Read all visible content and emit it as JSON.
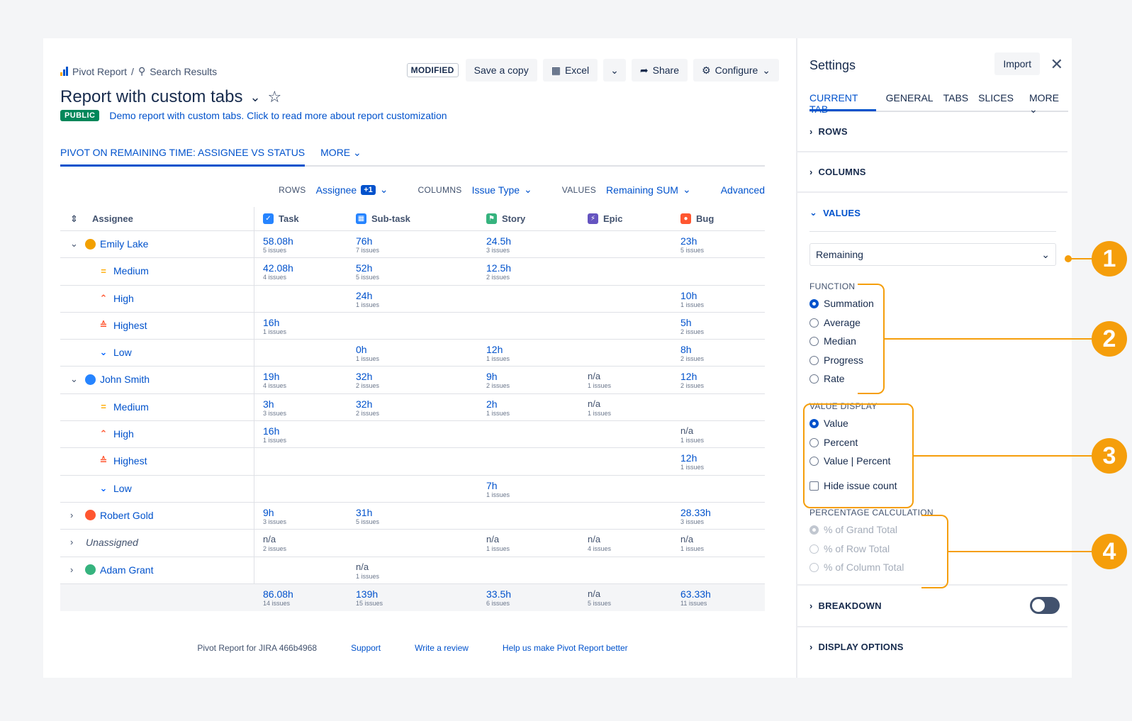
{
  "breadcrumb": {
    "root": "Pivot Report",
    "sep": "/",
    "current": "Search Results"
  },
  "toolbar": {
    "modified": "MODIFIED",
    "save_copy": "Save a copy",
    "excel": "Excel",
    "share": "Share",
    "configure": "Configure"
  },
  "report": {
    "title": "Report with custom tabs",
    "visibility": "PUBLIC",
    "description": "Demo report with custom tabs. Click to read more about report customization"
  },
  "tabs": {
    "active": "PIVOT ON REMAINING TIME: ASSIGNEE VS STATUS",
    "more": "MORE"
  },
  "config": {
    "rows_label": "ROWS",
    "rows_value": "Assignee",
    "rows_extra": "+1",
    "columns_label": "COLUMNS",
    "columns_value": "Issue Type",
    "values_label": "VALUES",
    "values_value": "Remaining SUM",
    "advanced": "Advanced"
  },
  "table": {
    "header": {
      "assignee": "Assignee",
      "task": "Task",
      "subtask": "Sub-task",
      "story": "Story",
      "epic": "Epic",
      "bug": "Bug"
    },
    "rows": [
      {
        "name": "Emily Lake",
        "task": [
          "58.08h",
          "5 issues"
        ],
        "subtask": [
          "76h",
          "7 issues"
        ],
        "story": [
          "24.5h",
          "3 issues"
        ],
        "bug": [
          "23h",
          "5 issues"
        ]
      },
      {
        "name": "Medium",
        "task": [
          "42.08h",
          "4 issues"
        ],
        "subtask": [
          "52h",
          "5 issues"
        ],
        "story": [
          "12.5h",
          "2 issues"
        ]
      },
      {
        "name": "High",
        "subtask": [
          "24h",
          "1 issues"
        ],
        "bug": [
          "10h",
          "1 issues"
        ]
      },
      {
        "name": "Highest",
        "task": [
          "16h",
          "1 issues"
        ],
        "bug": [
          "5h",
          "2 issues"
        ]
      },
      {
        "name": "Low",
        "subtask": [
          "0h",
          "1 issues"
        ],
        "story": [
          "12h",
          "1 issues"
        ],
        "bug": [
          "8h",
          "2 issues"
        ]
      },
      {
        "name": "John Smith",
        "task": [
          "19h",
          "4 issues"
        ],
        "subtask": [
          "32h",
          "2 issues"
        ],
        "story": [
          "9h",
          "2 issues"
        ],
        "epic": [
          "n/a",
          "1 issues"
        ],
        "bug": [
          "12h",
          "2 issues"
        ]
      },
      {
        "name": "Medium",
        "task": [
          "3h",
          "3 issues"
        ],
        "subtask": [
          "32h",
          "2 issues"
        ],
        "story": [
          "2h",
          "1 issues"
        ],
        "epic": [
          "n/a",
          "1 issues"
        ]
      },
      {
        "name": "High",
        "task": [
          "16h",
          "1 issues"
        ],
        "bug": [
          "n/a",
          "1 issues"
        ]
      },
      {
        "name": "Highest",
        "bug": [
          "12h",
          "1 issues"
        ]
      },
      {
        "name": "Low",
        "story": [
          "7h",
          "1 issues"
        ]
      },
      {
        "name": "Robert Gold",
        "task": [
          "9h",
          "3 issues"
        ],
        "subtask": [
          "31h",
          "5 issues"
        ],
        "bug": [
          "28.33h",
          "3 issues"
        ]
      },
      {
        "name": "Unassigned",
        "task": [
          "n/a",
          "2 issues"
        ],
        "story": [
          "n/a",
          "1 issues"
        ],
        "epic": [
          "n/a",
          "4 issues"
        ],
        "bug": [
          "n/a",
          "1 issues"
        ]
      },
      {
        "name": "Adam Grant",
        "subtask": [
          "n/a",
          "1 issues"
        ]
      }
    ],
    "total": {
      "task": [
        "86.08h",
        "14 issues"
      ],
      "subtask": [
        "139h",
        "15 issues"
      ],
      "story": [
        "33.5h",
        "6 issues"
      ],
      "epic": [
        "n/a",
        "5 issues"
      ],
      "bug": [
        "63.33h",
        "11 issues"
      ]
    }
  },
  "footer": {
    "product": "Pivot Report for JIRA 466b4968",
    "support": "Support",
    "review": "Write a review",
    "help": "Help us make Pivot Report better"
  },
  "settings": {
    "title": "Settings",
    "import": "Import",
    "tabs": [
      "CURRENT TAB",
      "GENERAL",
      "TABS",
      "SLICES"
    ],
    "more": "MORE",
    "sections": {
      "rows": "ROWS",
      "columns": "COLUMNS",
      "values": "VALUES",
      "breakdown": "BREAKDOWN",
      "display_options": "DISPLAY OPTIONS"
    },
    "value_field": "Remaining",
    "function": {
      "title": "FUNCTION",
      "options": [
        "Summation",
        "Average",
        "Median",
        "Progress",
        "Rate"
      ],
      "selected": "Summation"
    },
    "value_display": {
      "title": "VALUE DISPLAY",
      "options": [
        "Value",
        "Percent",
        "Value | Percent"
      ],
      "selected": "Value",
      "hide_count": "Hide issue count"
    },
    "percentage": {
      "title": "PERCENTAGE CALCULATION",
      "options": [
        "% of Grand Total",
        "% of Row Total",
        "% of Column Total"
      ],
      "selected": "% of Grand Total"
    },
    "breakdown_on": false
  },
  "annotations": [
    "1",
    "2",
    "3",
    "4"
  ],
  "colors": {
    "accent": "#0052cc",
    "annotation": "#f59e0b",
    "public": "#00875a"
  }
}
